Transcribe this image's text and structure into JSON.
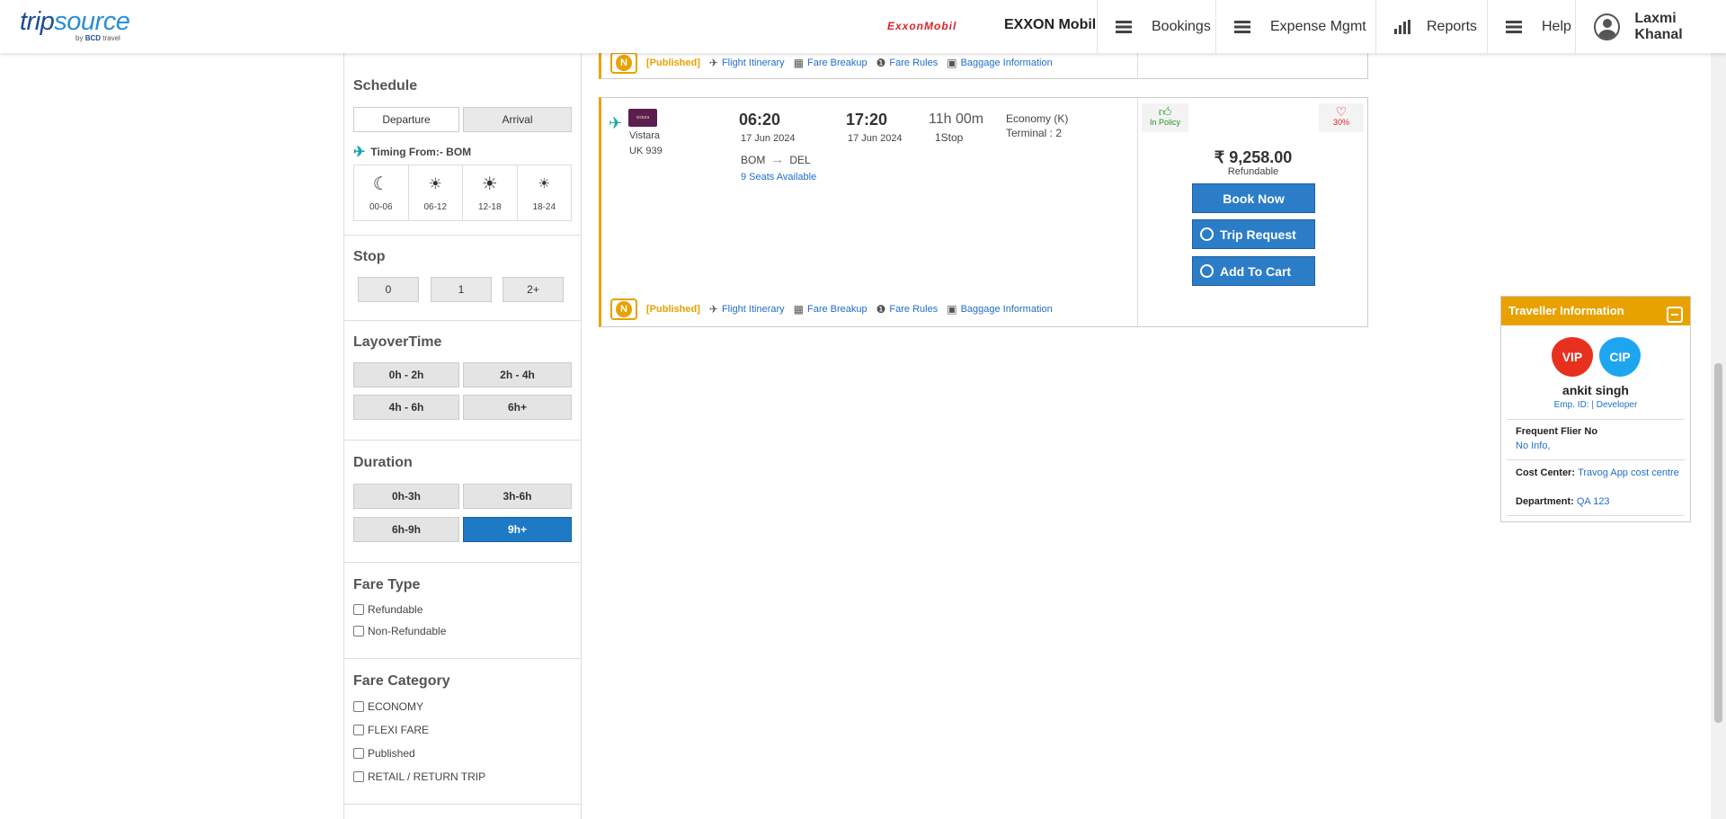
{
  "header": {
    "logo_trip": "trip",
    "logo_source": "source",
    "logo_by": "by",
    "logo_bcd": "BCD",
    "logo_travel": "travel",
    "client_logo": "ExxonMobil",
    "client_name": "EXXON Mobil",
    "nav": {
      "bookings": "Bookings",
      "expense": "Expense Mgmt",
      "reports": "Reports",
      "help": "Help"
    },
    "user_name": "Laxmi Khanal"
  },
  "filters": {
    "schedule": {
      "title": "Schedule",
      "departure": "Departure",
      "arrival": "Arrival",
      "timing_label": "Timing From:- BOM",
      "slots": [
        {
          "icon": "moon-icon",
          "glyph": "☾",
          "label": "00-06"
        },
        {
          "icon": "sunrise-icon",
          "glyph": "☀",
          "label": "06-12"
        },
        {
          "icon": "sun-icon",
          "glyph": "☀",
          "label": "12-18"
        },
        {
          "icon": "sunset-icon",
          "glyph": "☀",
          "label": "18-24"
        }
      ]
    },
    "stop": {
      "title": "Stop",
      "options": [
        "0",
        "1",
        "2+"
      ]
    },
    "layover": {
      "title": "LayoverTime",
      "options": [
        "0h - 2h",
        "2h - 4h",
        "4h - 6h",
        "6h+"
      ]
    },
    "duration": {
      "title": "Duration",
      "options": [
        "0h-3h",
        "3h-6h",
        "6h-9h",
        "9h+"
      ],
      "selected": "9h+"
    },
    "fare_type": {
      "title": "Fare Type",
      "options": [
        "Refundable",
        "Non-Refundable"
      ]
    },
    "fare_category": {
      "title": "Fare Category",
      "options": [
        "ECONOMY",
        "FLEXI FARE",
        "Published",
        "RETAIL / RETURN TRIP"
      ]
    }
  },
  "card_links": {
    "badge": "N",
    "published": "[Published]",
    "itinerary": "Flight Itinerary",
    "fare_breakup": "Fare Breakup",
    "fare_rules": "Fare Rules",
    "baggage": "Baggage Information"
  },
  "flight": {
    "airline": "Vistara",
    "logo_text": "vistara",
    "flight_no": "UK  939",
    "dep_time": "06:20",
    "dep_date": "17 Jun 2024",
    "arr_time": "17:20",
    "arr_date": "17 Jun 2024",
    "from": "BOM",
    "to": "DEL",
    "duration": "11h 00m",
    "stops": "1Stop",
    "seats": "9 Seats Available",
    "cabin": "Economy (K)",
    "terminal": "Terminal : 2",
    "policy": "In Policy",
    "heart_pct": "30%",
    "price": "₹ 9,258.00",
    "refund": "Refundable",
    "book_now": "Book Now",
    "trip_request": "Trip Request",
    "add_to_cart": "Add To Cart"
  },
  "traveller": {
    "title": "Traveller Information",
    "vip": "VIP",
    "cip": "CIP",
    "name": "ankit singh",
    "emp": "Emp. ID: | Developer",
    "ff_label": "Frequent Flier No",
    "ff_value": "No Info,",
    "cc_label": "Cost Center",
    "cc_value": "Travog App cost centre",
    "dept_label": "Department",
    "dept_value": "QA 123"
  },
  "colors": {
    "accent": "#e8a200",
    "primary": "#2c7dc8",
    "link": "#1f6ec8"
  }
}
